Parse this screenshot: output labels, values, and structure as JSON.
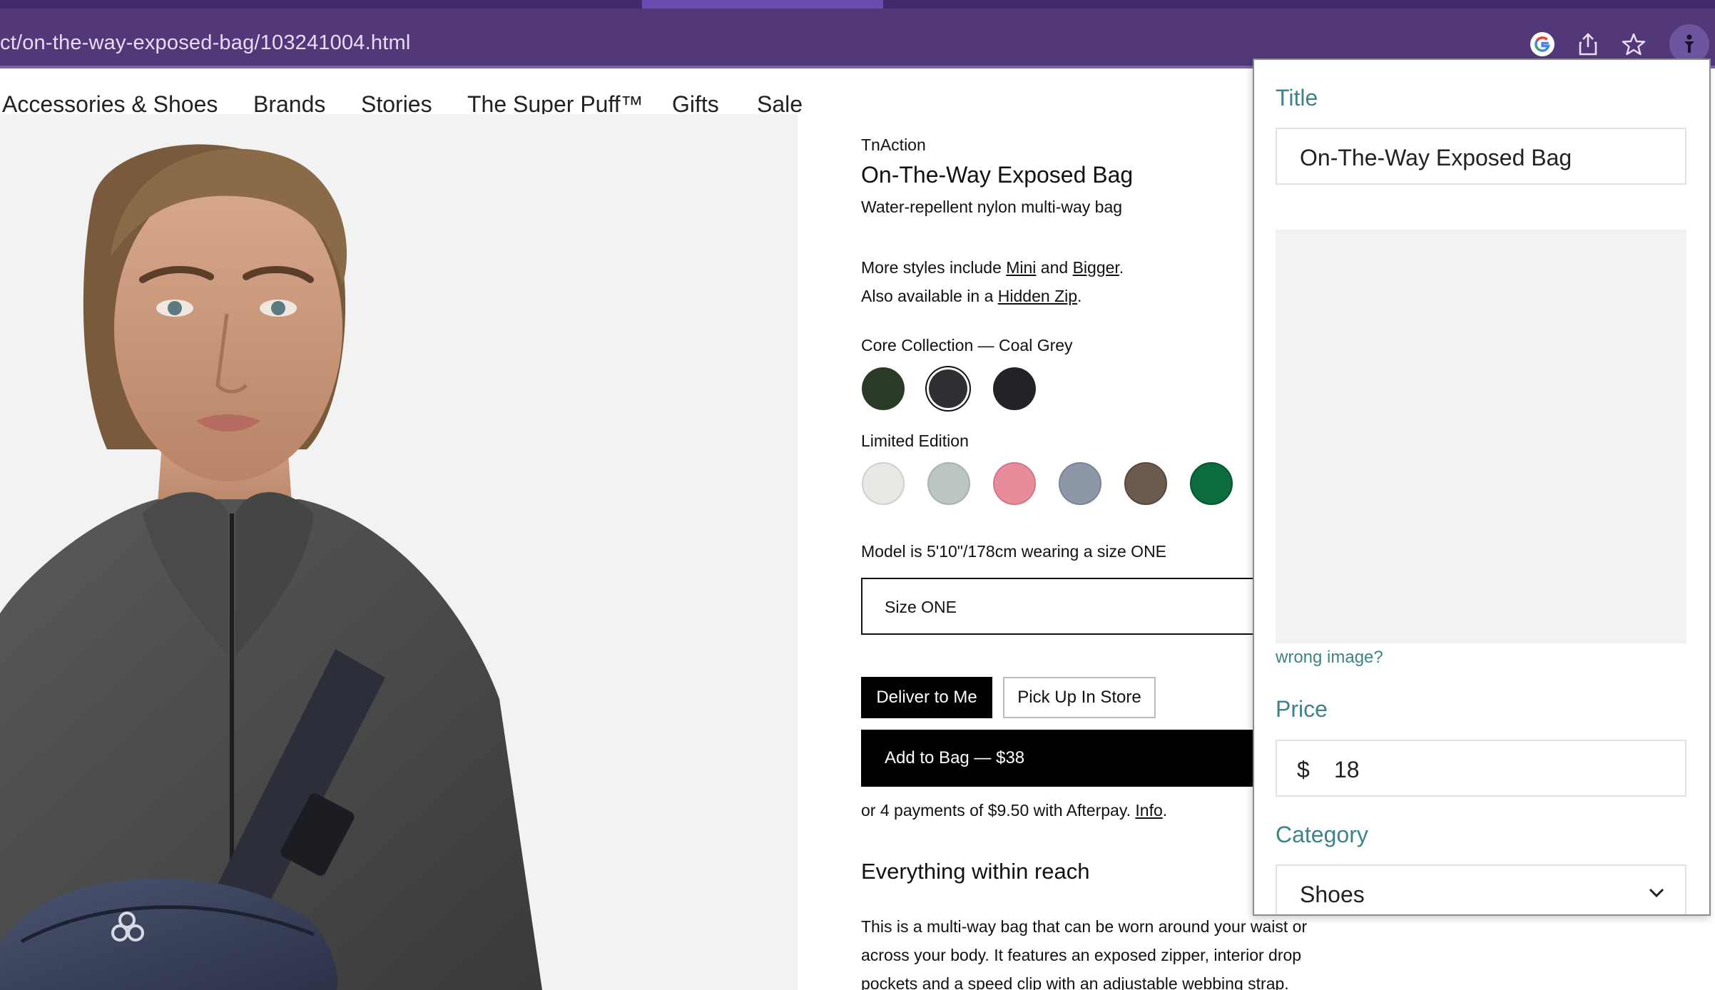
{
  "browser": {
    "url": "ct/on-the-way-exposed-bag/103241004.html",
    "icons": [
      "google-icon",
      "share-icon",
      "star-icon",
      "extension-icon"
    ],
    "colors": {
      "chrome": "#523879",
      "tabstrip": "#3f2a6b"
    }
  },
  "nav": {
    "items": [
      "Accessories & Shoes",
      "Brands",
      "Stories",
      "The Super Puff™",
      "Gifts",
      "Sale"
    ]
  },
  "product": {
    "brand": "TnAction",
    "title": "On-The-Way Exposed Bag",
    "subtitle": "Water-repellent nylon multi-way bag",
    "more_styles_prefix": "More styles include ",
    "more_styles_mini": "Mini",
    "more_styles_and": " and ",
    "more_styles_bigger": "Bigger",
    "more_styles_end": ".",
    "also_prefix": "Also available in a ",
    "also_link": "Hidden Zip",
    "also_end": ".",
    "core_label": "Core Collection — Coal Grey",
    "core_swatches": [
      "#2b3a26",
      "#2e3034",
      "#222326"
    ],
    "limited_label": "Limited Edition",
    "limited_swatches": [
      "#e9e9e4",
      "#bcc6c1",
      "#e88b9b",
      "#8d97a7",
      "#6b5b4f",
      "#0c6b3f"
    ],
    "model_note": "Model is 5'10\"/178cm wearing a size ONE",
    "size_value": "Size ONE",
    "deliver_label": "Deliver to Me",
    "pickup_label": "Pick Up In Store",
    "add_label": "Add to Bag — $38",
    "afterpay_text": "or 4 payments of $9.50 with Afterpay. ",
    "afterpay_link": "Info",
    "afterpay_end": ".",
    "reach_heading": "Everything within reach",
    "desc_line1": "This is a multi-way bag that can be worn around your waist or",
    "desc_line2": "across your body. It features an exposed zipper, interior drop",
    "desc_line3": "pockets and a speed clip with an adjustable webbing strap."
  },
  "popup": {
    "title_label": "Title",
    "title_value": "On-The-Way Exposed Bag",
    "wrong_image": "wrong image?",
    "price_label": "Price",
    "currency": "$",
    "price_value": "18",
    "category_label": "Category",
    "category_value": "Shoes",
    "accent": "#3d8388"
  }
}
